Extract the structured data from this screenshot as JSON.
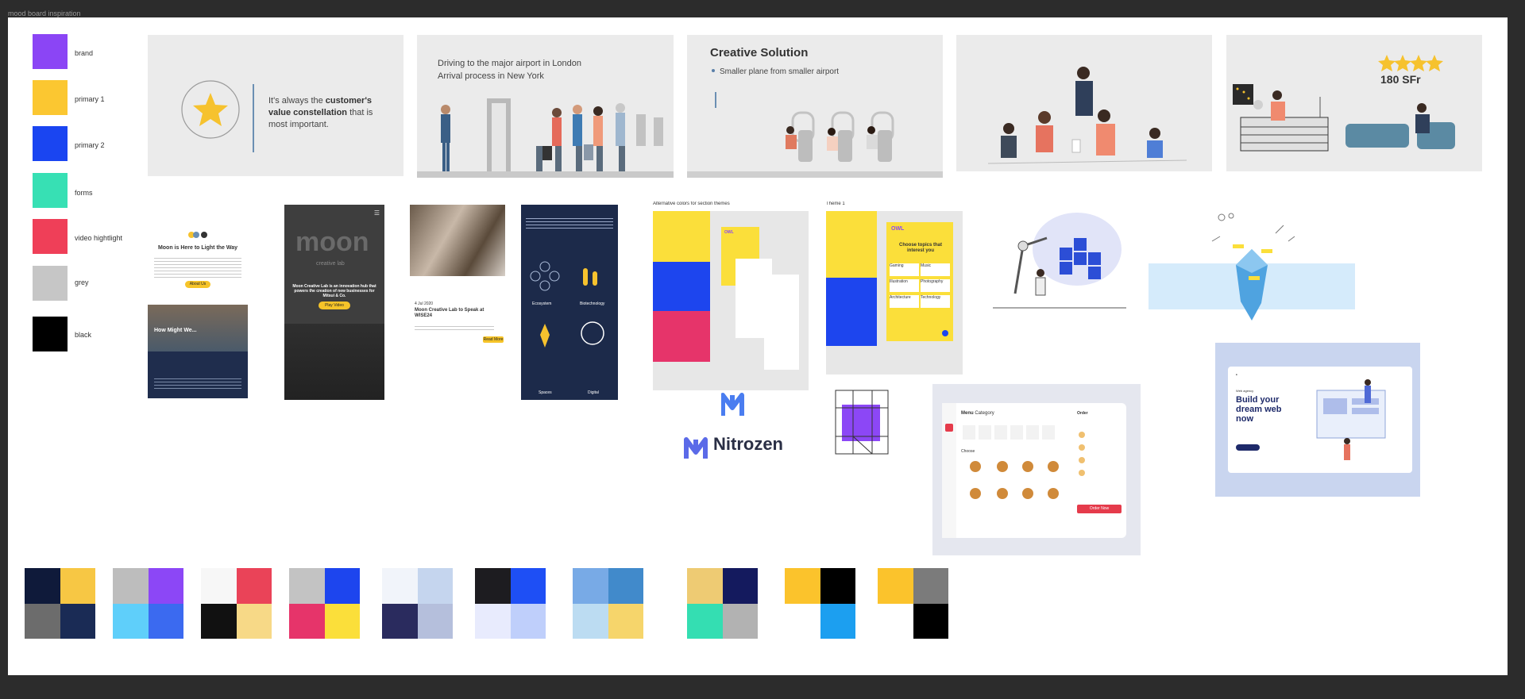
{
  "frame": {
    "title": "mood board inspiration"
  },
  "colors": {
    "brand": "#8b45f5",
    "primary1": "#fbc731",
    "primary2": "#1a45f1",
    "forms": "#37e0b4",
    "video_highlight": "#ef3f58",
    "grey": "#c6c6c6",
    "black": "#000000"
  },
  "swatches": [
    {
      "label": "brand",
      "color": "#8b45f5"
    },
    {
      "label": "primary 1",
      "color": "#fbc731"
    },
    {
      "label": "primary 2",
      "color": "#1a45f1"
    },
    {
      "label": "forms",
      "color": "#37e0b4"
    },
    {
      "label": "video hightlight",
      "color": "#ef3f58"
    },
    {
      "label": "grey",
      "color": "#c6c6c6"
    },
    {
      "label": "black",
      "color": "#000000"
    }
  ],
  "cards": {
    "quote": {
      "pre": "It's always the ",
      "bold": "customer's value constellation",
      "post": " that is most important."
    },
    "airport": {
      "line1": "Driving to the major airport in London",
      "line2": "Arrival process in New York"
    },
    "creative": {
      "title": "Creative Solution",
      "bullet": "Smaller plane from smaller airport"
    },
    "hotel": {
      "price": "180 SFr",
      "stars": 4
    }
  },
  "moon": {
    "headline": "Moon is Here to Light the Way",
    "about_button": "About Us",
    "how_might": "How Might We...",
    "wordmark": "moon",
    "sub_wordmark": "creative lab",
    "hub_text": "Moon Creative Lab is an innovation hub that powers the creation of new businesses for Mitsui & Co.",
    "play_button": "Play Video",
    "date": "4 Jul 2020",
    "article_title": "Moon Creative Lab to Speak at WISE24",
    "read_more": "Read More",
    "grid_labels": [
      "Ecosystem",
      "Biotechnology",
      "Spaces",
      "Digital"
    ]
  },
  "themes": {
    "alt_title": "Alternative colors for section themes",
    "theme_label": "Theme 1",
    "owl_logo": "OWL",
    "topics_title": "Choose topics that interest you",
    "topics": [
      "Gaming",
      "Music",
      "Illustration",
      "Photography",
      "Architecture",
      "Technology"
    ]
  },
  "nitrozen": {
    "name": "Nitrozen"
  },
  "menu_app": {
    "title": "Menu",
    "subtitle": "Category",
    "order": "Order",
    "choose": "Choose",
    "button": "Order Now"
  },
  "web_agency": {
    "headline": "Build your dream web now",
    "kicker": "Web agency"
  },
  "palettes": [
    [
      "#0f1a3a",
      "#f7c744",
      "#6c6c6c",
      "#1a2b55"
    ],
    [
      "#bdbdbd",
      "#8c47f6",
      "#5fcffa",
      "#3b6af0"
    ],
    [
      "#f7f7f7",
      "#ea4358",
      "#111111",
      "#f7d987"
    ],
    [
      "#c3c3c3",
      "#1d45ee",
      "#e6346a",
      "#fbdf3a"
    ],
    [
      "#f1f4fa",
      "#c5d5ee",
      "#2a2b5e",
      "#b5bfdc"
    ],
    [
      "#1d1c20",
      "#1e4ff5",
      "#e8ebfd",
      "#bfcffb"
    ],
    [
      "#78aae6",
      "#418acb",
      "#bcdcf2",
      "#f6d56b"
    ],
    [
      "#eecb73",
      "#141a5e",
      "#34deb2",
      "#b2b2b2"
    ],
    [
      "#fbc32c",
      "#000000",
      "#ffffff",
      "#1c9ff0"
    ],
    [
      "#fbc32c",
      "#7b7b7b",
      "#ffffff",
      "#000000"
    ]
  ]
}
